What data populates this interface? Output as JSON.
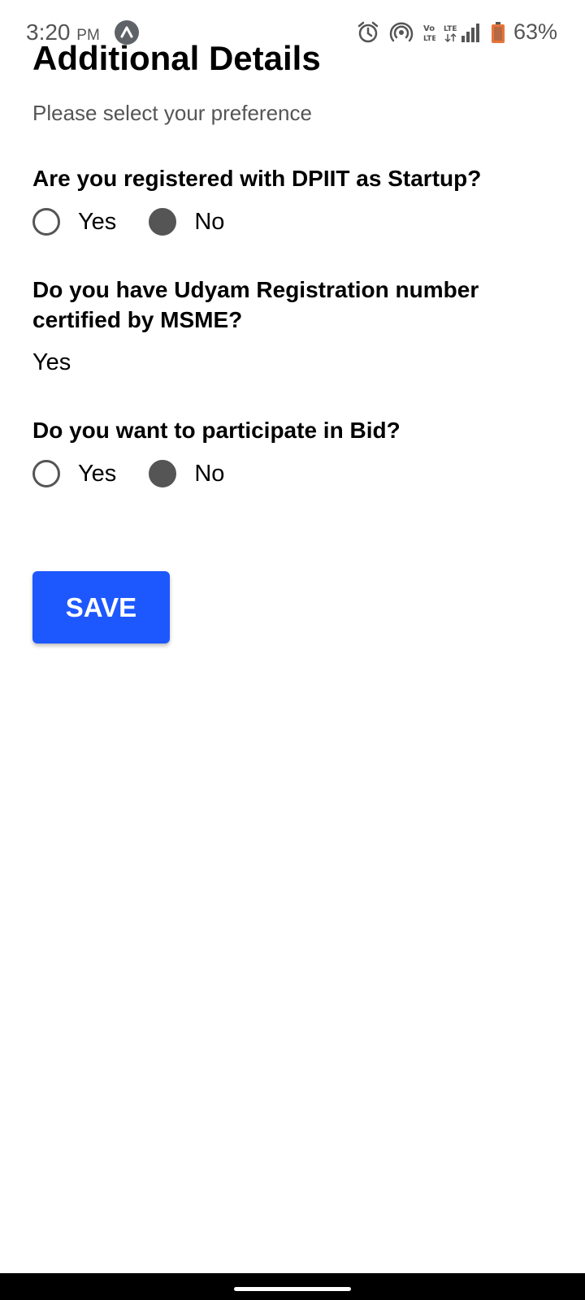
{
  "status_bar": {
    "time": "3:20",
    "ampm": "PM",
    "battery": "63%",
    "icons": [
      "app-notification-icon",
      "alarm-icon",
      "hotspot-icon",
      "volte-icon",
      "lte-icon",
      "signal-icon",
      "battery-icon"
    ]
  },
  "page": {
    "title": "Additional Details",
    "subtitle": "Please select your preference"
  },
  "questions": [
    {
      "text": "Are you registered with DPIIT as Startup?",
      "options": [
        {
          "label": "Yes",
          "selected": false
        },
        {
          "label": "No",
          "selected": true
        }
      ]
    },
    {
      "text": "Do you have Udyam Registration number certified by MSME?",
      "answer": "Yes"
    },
    {
      "text": "Do you want to participate in Bid?",
      "options": [
        {
          "label": "Yes",
          "selected": false
        },
        {
          "label": "No",
          "selected": true
        }
      ]
    }
  ],
  "save_button": {
    "label": "SAVE",
    "color": "#1d58ff"
  }
}
